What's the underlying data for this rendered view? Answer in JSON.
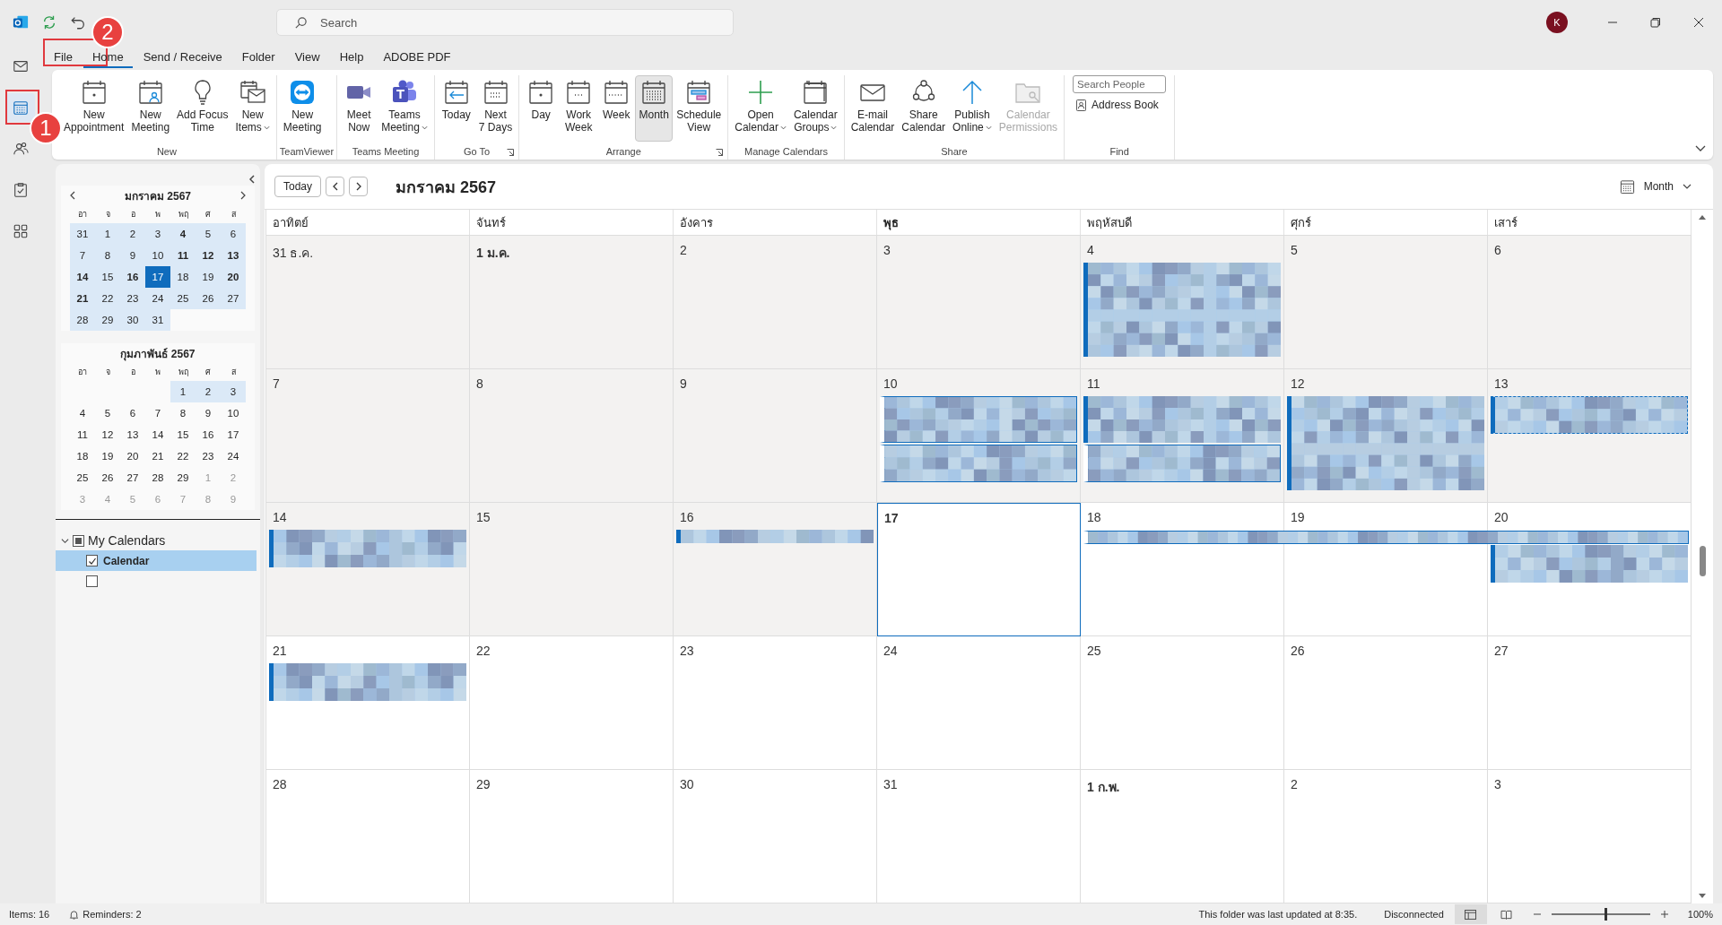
{
  "titlebar": {
    "search_placeholder": "Search",
    "avatar": "K"
  },
  "nav": [
    {
      "kind": "mail",
      "selected": false
    },
    {
      "kind": "calendar",
      "selected": true,
      "callout": "1"
    },
    {
      "kind": "people",
      "selected": false
    },
    {
      "kind": "tasks",
      "selected": false
    },
    {
      "kind": "apps",
      "selected": false
    }
  ],
  "tabs": [
    {
      "label": "File",
      "selected": false,
      "callout": "2"
    },
    {
      "label": "Home",
      "selected": true
    },
    {
      "label": "Send / Receive",
      "selected": false
    },
    {
      "label": "Folder",
      "selected": false
    },
    {
      "label": "View",
      "selected": false
    },
    {
      "label": "Help",
      "selected": false
    },
    {
      "label": "ADOBE PDF",
      "selected": false
    }
  ],
  "ribbon": {
    "groups": [
      {
        "label": "New",
        "buttons": [
          {
            "kind": "appointment",
            "lines": [
              "New",
              "Appointment"
            ],
            "disabled": false,
            "selected": false
          },
          {
            "kind": "meeting",
            "lines": [
              "New",
              "Meeting"
            ],
            "disabled": false,
            "selected": false
          },
          {
            "kind": "bulb",
            "lines": [
              "Add Focus",
              "Time"
            ],
            "disabled": false,
            "selected": false
          },
          {
            "kind": "items",
            "lines": [
              "New",
              "Items"
            ],
            "dropdown": true,
            "disabled": false,
            "selected": false
          }
        ]
      },
      {
        "label": "TeamViewer",
        "buttons": [
          {
            "kind": "teamviewer",
            "lines": [
              "New",
              "Meeting"
            ],
            "disabled": false,
            "selected": false
          }
        ]
      },
      {
        "label": "Teams Meeting",
        "buttons": [
          {
            "kind": "camera",
            "lines": [
              "Meet",
              "Now"
            ],
            "disabled": false,
            "selected": false
          },
          {
            "kind": "teams",
            "lines": [
              "Teams",
              "Meeting"
            ],
            "dropdown": true,
            "disabled": false,
            "selected": false
          }
        ]
      },
      {
        "label": "Go To",
        "launcher": true,
        "buttons": [
          {
            "kind": "today",
            "lines": [
              "Today"
            ],
            "disabled": false,
            "selected": false
          },
          {
            "kind": "next7",
            "lines": [
              "Next",
              "7 Days"
            ],
            "disabled": false,
            "selected": false
          }
        ]
      },
      {
        "label": "Arrange",
        "launcher": true,
        "buttons": [
          {
            "kind": "day",
            "lines": [
              "Day"
            ],
            "disabled": false,
            "selected": false
          },
          {
            "kind": "workweek",
            "lines": [
              "Work",
              "Week"
            ],
            "disabled": false,
            "selected": false
          },
          {
            "kind": "week",
            "lines": [
              "Week"
            ],
            "disabled": false,
            "selected": false
          },
          {
            "kind": "month",
            "lines": [
              "Month"
            ],
            "disabled": false,
            "selected": true
          },
          {
            "kind": "schedule",
            "lines": [
              "Schedule",
              "View"
            ],
            "disabled": false,
            "selected": false
          }
        ]
      },
      {
        "label": "Manage Calendars",
        "buttons": [
          {
            "kind": "plus",
            "lines": [
              "Open",
              "Calendar"
            ],
            "dropdown": true,
            "disabled": false,
            "selected": false
          },
          {
            "kind": "groups",
            "lines": [
              "Calendar",
              "Groups"
            ],
            "dropdown": true,
            "disabled": false,
            "selected": false
          }
        ]
      },
      {
        "label": "Share",
        "buttons": [
          {
            "kind": "mail",
            "lines": [
              "E-mail",
              "Calendar"
            ],
            "disabled": false,
            "selected": false
          },
          {
            "kind": "share",
            "lines": [
              "Share",
              "Calendar"
            ],
            "disabled": false,
            "selected": false
          },
          {
            "kind": "publish",
            "lines": [
              "Publish",
              "Online"
            ],
            "dropdown": true,
            "disabled": false,
            "selected": false
          },
          {
            "kind": "permissions",
            "lines": [
              "Calendar",
              "Permissions"
            ],
            "disabled": true,
            "selected": false
          }
        ]
      }
    ],
    "find": {
      "label": "Find",
      "search_placeholder": "Search People",
      "link": "Address Book"
    }
  },
  "sidebar": {
    "months": [
      {
        "title": "มกราคม 2567",
        "weekdays": [
          "อา",
          "จ",
          "อ",
          "พ",
          "พฤ",
          "ศ",
          "ส"
        ],
        "weeks": [
          [
            {
              "n": "31",
              "busy": false,
              "shaded": true,
              "muted": false,
              "selected": false
            },
            {
              "n": "1",
              "busy": false,
              "shaded": true,
              "muted": false,
              "selected": false
            },
            {
              "n": "2",
              "busy": false,
              "shaded": true,
              "muted": false,
              "selected": false
            },
            {
              "n": "3",
              "busy": false,
              "shaded": true,
              "muted": false,
              "selected": false
            },
            {
              "n": "4",
              "busy": true,
              "shaded": true,
              "muted": false,
              "selected": false
            },
            {
              "n": "5",
              "busy": false,
              "shaded": true,
              "muted": false,
              "selected": false
            },
            {
              "n": "6",
              "busy": false,
              "shaded": true,
              "muted": false,
              "selected": false
            }
          ],
          [
            {
              "n": "7",
              "busy": false,
              "shaded": true,
              "muted": false,
              "selected": false
            },
            {
              "n": "8",
              "busy": false,
              "shaded": true,
              "muted": false,
              "selected": false
            },
            {
              "n": "9",
              "busy": false,
              "shaded": true,
              "muted": false,
              "selected": false
            },
            {
              "n": "10",
              "busy": false,
              "shaded": true,
              "muted": false,
              "selected": false
            },
            {
              "n": "11",
              "busy": true,
              "shaded": true,
              "muted": false,
              "selected": false
            },
            {
              "n": "12",
              "busy": true,
              "shaded": true,
              "muted": false,
              "selected": false
            },
            {
              "n": "13",
              "busy": true,
              "shaded": true,
              "muted": false,
              "selected": false
            }
          ],
          [
            {
              "n": "14",
              "busy": true,
              "shaded": true,
              "muted": false,
              "selected": false
            },
            {
              "n": "15",
              "busy": false,
              "shaded": true,
              "muted": false,
              "selected": false
            },
            {
              "n": "16",
              "busy": true,
              "shaded": true,
              "muted": false,
              "selected": false
            },
            {
              "n": "17",
              "busy": false,
              "shaded": true,
              "muted": false,
              "selected": true
            },
            {
              "n": "18",
              "busy": false,
              "shaded": true,
              "muted": false,
              "selected": false
            },
            {
              "n": "19",
              "busy": false,
              "shaded": true,
              "muted": false,
              "selected": false
            },
            {
              "n": "20",
              "busy": true,
              "shaded": true,
              "muted": false,
              "selected": false
            }
          ],
          [
            {
              "n": "21",
              "busy": true,
              "shaded": true,
              "muted": false,
              "selected": false
            },
            {
              "n": "22",
              "busy": false,
              "shaded": true,
              "muted": false,
              "selected": false
            },
            {
              "n": "23",
              "busy": false,
              "shaded": true,
              "muted": false,
              "selected": false
            },
            {
              "n": "24",
              "busy": false,
              "shaded": true,
              "muted": false,
              "selected": false
            },
            {
              "n": "25",
              "busy": false,
              "shaded": true,
              "muted": false,
              "selected": false
            },
            {
              "n": "26",
              "busy": false,
              "shaded": true,
              "muted": false,
              "selected": false
            },
            {
              "n": "27",
              "busy": false,
              "shaded": true,
              "muted": false,
              "selected": false
            }
          ],
          [
            {
              "n": "28",
              "busy": false,
              "shaded": true,
              "muted": false,
              "selected": false
            },
            {
              "n": "29",
              "busy": false,
              "shaded": true,
              "muted": false,
              "selected": false
            },
            {
              "n": "30",
              "busy": false,
              "shaded": true,
              "muted": false,
              "selected": false
            },
            {
              "n": "31",
              "busy": false,
              "shaded": true,
              "muted": false,
              "selected": false
            }
          ]
        ]
      },
      {
        "title": "กุมภาพันธ์ 2567",
        "weekdays": [
          "อา",
          "จ",
          "อ",
          "พ",
          "พฤ",
          "ศ",
          "ส"
        ],
        "weeks": [
          [
            {
              "n": "1",
              "busy": false,
              "shaded": true,
              "muted": false,
              "selected": false
            },
            {
              "n": "2",
              "busy": false,
              "shaded": true,
              "muted": false,
              "selected": false
            },
            {
              "n": "3",
              "busy": false,
              "shaded": true,
              "muted": false,
              "selected": false
            }
          ],
          [
            {
              "n": "4",
              "busy": false,
              "shaded": false,
              "muted": false,
              "selected": false
            },
            {
              "n": "5",
              "busy": false,
              "shaded": false,
              "muted": false,
              "selected": false
            },
            {
              "n": "6",
              "busy": false,
              "shaded": false,
              "muted": false,
              "selected": false
            },
            {
              "n": "7",
              "busy": false,
              "shaded": false,
              "muted": false,
              "selected": false
            },
            {
              "n": "8",
              "busy": false,
              "shaded": false,
              "muted": false,
              "selected": false
            },
            {
              "n": "9",
              "busy": false,
              "shaded": false,
              "muted": false,
              "selected": false
            },
            {
              "n": "10",
              "busy": false,
              "shaded": false,
              "muted": false,
              "selected": false
            }
          ],
          [
            {
              "n": "11",
              "busy": false,
              "shaded": false,
              "muted": false,
              "selected": false
            },
            {
              "n": "12",
              "busy": false,
              "shaded": false,
              "muted": false,
              "selected": false
            },
            {
              "n": "13",
              "busy": false,
              "shaded": false,
              "muted": false,
              "selected": false
            },
            {
              "n": "14",
              "busy": false,
              "shaded": false,
              "muted": false,
              "selected": false
            },
            {
              "n": "15",
              "busy": false,
              "shaded": false,
              "muted": false,
              "selected": false
            },
            {
              "n": "16",
              "busy": false,
              "shaded": false,
              "muted": false,
              "selected": false
            },
            {
              "n": "17",
              "busy": false,
              "shaded": false,
              "muted": false,
              "selected": false
            }
          ],
          [
            {
              "n": "18",
              "busy": false,
              "shaded": false,
              "muted": false,
              "selected": false
            },
            {
              "n": "19",
              "busy": false,
              "shaded": false,
              "muted": false,
              "selected": false
            },
            {
              "n": "20",
              "busy": false,
              "shaded": false,
              "muted": false,
              "selected": false
            },
            {
              "n": "21",
              "busy": false,
              "shaded": false,
              "muted": false,
              "selected": false
            },
            {
              "n": "22",
              "busy": false,
              "shaded": false,
              "muted": false,
              "selected": false
            },
            {
              "n": "23",
              "busy": false,
              "shaded": false,
              "muted": false,
              "selected": false
            },
            {
              "n": "24",
              "busy": false,
              "shaded": false,
              "muted": false,
              "selected": false
            }
          ],
          [
            {
              "n": "25",
              "busy": false,
              "shaded": false,
              "muted": false,
              "selected": false
            },
            {
              "n": "26",
              "busy": false,
              "shaded": false,
              "muted": false,
              "selected": false
            },
            {
              "n": "27",
              "busy": false,
              "shaded": false,
              "muted": false,
              "selected": false
            },
            {
              "n": "28",
              "busy": false,
              "shaded": false,
              "muted": false,
              "selected": false
            },
            {
              "n": "29",
              "busy": false,
              "shaded": false,
              "muted": false,
              "selected": false
            },
            {
              "n": "1",
              "busy": false,
              "shaded": false,
              "muted": true,
              "selected": false
            },
            {
              "n": "2",
              "busy": false,
              "shaded": false,
              "muted": true,
              "selected": false
            }
          ],
          [
            {
              "n": "3",
              "busy": false,
              "shaded": false,
              "muted": true,
              "selected": false
            },
            {
              "n": "4",
              "busy": false,
              "shaded": false,
              "muted": true,
              "selected": false
            },
            {
              "n": "5",
              "busy": false,
              "shaded": false,
              "muted": true,
              "selected": false
            },
            {
              "n": "6",
              "busy": false,
              "shaded": false,
              "muted": true,
              "selected": false
            },
            {
              "n": "7",
              "busy": false,
              "shaded": false,
              "muted": true,
              "selected": false
            },
            {
              "n": "8",
              "busy": false,
              "shaded": false,
              "muted": true,
              "selected": false
            },
            {
              "n": "9",
              "busy": false,
              "shaded": false,
              "muted": true,
              "selected": false
            }
          ]
        ]
      }
    ],
    "folder_group": {
      "label": "My Calendars",
      "expanded": true,
      "partial": true,
      "items": [
        {
          "label": "Calendar",
          "checked": true,
          "selected": true
        },
        {
          "checked": false,
          "selected": false
        }
      ]
    }
  },
  "calendar": {
    "today_button": "Today",
    "title": "มกราคม 2567",
    "view": "Month",
    "weekdays": [
      {
        "label": "อาทิตย์",
        "selected": false
      },
      {
        "label": "จันทร์",
        "selected": false
      },
      {
        "label": "อังคาร",
        "selected": false
      },
      {
        "label": "พุธ",
        "selected": true
      },
      {
        "label": "พฤหัสบดี",
        "selected": false
      },
      {
        "label": "ศุกร์",
        "selected": false
      },
      {
        "label": "เสาร์",
        "selected": false
      }
    ],
    "weeks": [
      {
        "days": [
          {
            "label": "31 ธ.ค.",
            "bold": false,
            "today": false,
            "past": true
          },
          {
            "label": "1 ม.ค.",
            "bold": true,
            "today": false,
            "past": true
          },
          {
            "label": "2",
            "bold": false,
            "today": false,
            "past": true
          },
          {
            "label": "3",
            "bold": false,
            "today": false,
            "past": true
          },
          {
            "label": "4",
            "bold": false,
            "today": false,
            "past": true,
            "events": [
              {
                "kind": "tall",
                "free": false
              }
            ]
          },
          {
            "label": "5",
            "bold": false,
            "today": false,
            "past": true
          },
          {
            "label": "6",
            "bold": false,
            "today": false,
            "past": true
          }
        ]
      },
      {
        "days": [
          {
            "label": "7",
            "bold": false,
            "today": false,
            "past": true
          },
          {
            "label": "8",
            "bold": false,
            "today": false,
            "past": true
          },
          {
            "label": "9",
            "bold": false,
            "today": false,
            "past": true
          },
          {
            "label": "10",
            "bold": false,
            "today": false,
            "past": true,
            "events": [
              {
                "kind": "medium",
                "free": true
              },
              {
                "kind": "short",
                "free": true
              }
            ]
          },
          {
            "label": "11",
            "bold": false,
            "today": false,
            "past": true,
            "events": [
              {
                "kind": "medium",
                "free": false
              },
              {
                "kind": "short",
                "free": true
              }
            ]
          },
          {
            "label": "12",
            "bold": false,
            "today": false,
            "past": true,
            "events": [
              {
                "kind": "tall",
                "free": false
              }
            ]
          },
          {
            "label": "13",
            "bold": false,
            "today": false,
            "past": true,
            "events": [
              {
                "kind": "tentative",
                "free": false
              }
            ]
          }
        ]
      },
      {
        "days": [
          {
            "label": "14",
            "bold": false,
            "today": false,
            "past": true,
            "events": [
              {
                "kind": "short",
                "free": false
              }
            ]
          },
          {
            "label": "15",
            "bold": false,
            "today": false,
            "past": true
          },
          {
            "label": "16",
            "bold": false,
            "today": false,
            "past": true,
            "events": [
              {
                "kind": "thin",
                "free": false
              }
            ]
          },
          {
            "label": "17",
            "bold": true,
            "today": true,
            "past": false
          },
          {
            "label": "18",
            "bold": false,
            "today": false,
            "past": false,
            "events": [
              {
                "kind": "wide",
                "free": true
              }
            ]
          },
          {
            "label": "19",
            "bold": false,
            "today": false,
            "past": false
          },
          {
            "label": "20",
            "bold": false,
            "today": false,
            "past": false,
            "events": [
              {
                "kind": "short",
                "free": false
              }
            ]
          }
        ]
      },
      {
        "days": [
          {
            "label": "21",
            "bold": false,
            "today": false,
            "past": false,
            "events": [
              {
                "kind": "short",
                "free": false
              }
            ]
          },
          {
            "label": "22",
            "bold": false,
            "today": false,
            "past": false
          },
          {
            "label": "23",
            "bold": false,
            "today": false,
            "past": false
          },
          {
            "label": "24",
            "bold": false,
            "today": false,
            "past": false
          },
          {
            "label": "25",
            "bold": false,
            "today": false,
            "past": false
          },
          {
            "label": "26",
            "bold": false,
            "today": false,
            "past": false
          },
          {
            "label": "27",
            "bold": false,
            "today": false,
            "past": false
          }
        ]
      },
      {
        "days": [
          {
            "label": "28",
            "bold": false,
            "today": false,
            "past": false
          },
          {
            "label": "29",
            "bold": false,
            "today": false,
            "past": false
          },
          {
            "label": "30",
            "bold": false,
            "today": false,
            "past": false
          },
          {
            "label": "31",
            "bold": false,
            "today": false,
            "past": false
          },
          {
            "label": "1 ก.พ.",
            "bold": true,
            "today": false,
            "past": false
          },
          {
            "label": "2",
            "bold": false,
            "today": false,
            "past": false
          },
          {
            "label": "3",
            "bold": false,
            "today": false,
            "past": false
          }
        ]
      }
    ]
  },
  "status_bar": {
    "items": "Items: 16",
    "reminders": "Reminders: 2",
    "updated": "This folder was last updated at 8:35.",
    "connection": "Disconnected",
    "views": [
      {
        "kind": "normal",
        "selected": true
      },
      {
        "kind": "reading",
        "selected": false
      }
    ],
    "zoom": {
      "level": 0.55
    },
    "zoom_text": "100%"
  }
}
